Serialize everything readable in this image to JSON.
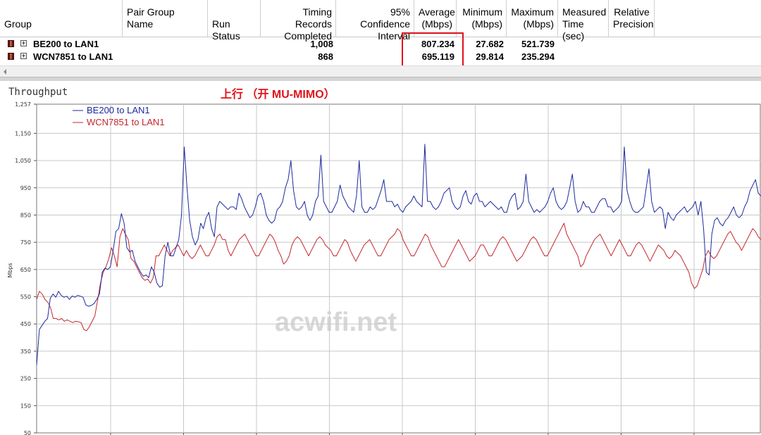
{
  "table": {
    "columns": [
      {
        "key": "group",
        "label": "Group"
      },
      {
        "key": "pair_group_name",
        "label": "Pair Group\nName"
      },
      {
        "key": "run_status",
        "label": "Run Status"
      },
      {
        "key": "timing_records",
        "label": "Timing Records\nCompleted"
      },
      {
        "key": "confidence",
        "label": "95% Confidence\nInterval"
      },
      {
        "key": "average",
        "label": "Average\n(Mbps)"
      },
      {
        "key": "minimum",
        "label": "Minimum\n(Mbps)"
      },
      {
        "key": "maximum",
        "label": "Maximum\n(Mbps)"
      },
      {
        "key": "measured_time",
        "label": "Measured\nTime (sec)"
      },
      {
        "key": "relative_precision",
        "label": "Relative\nPrecision"
      }
    ],
    "rows": [
      {
        "group": "BE200 to LAN1",
        "timing_records": "1,008",
        "average": "807.234",
        "minimum": "27.682",
        "maximum": "521.739"
      },
      {
        "group": "WCN7851 to LAN1",
        "timing_records": "868",
        "average": "695.119",
        "minimum": "29.814",
        "maximum": "235.294"
      }
    ]
  },
  "chart_title_label": "Throughput",
  "annotation": "上行 （开 MU-MIMO）",
  "watermark": "acwifi.net",
  "colors": {
    "highlight": "#e0101a",
    "annotation": "#e0121a",
    "series_blue": "#1c2a9e",
    "series_red": "#c4262b",
    "grid": "#c8c8c8"
  },
  "chart_data": {
    "type": "line",
    "ylabel": "Mbps",
    "ylim": [
      50,
      1257
    ],
    "y_ticks": [
      "50",
      "150",
      "250",
      "350",
      "450",
      "550",
      "650",
      "750",
      "850",
      "950",
      "1,050",
      "1,150",
      "1,257"
    ],
    "legend_placement": "top-left",
    "grid": true,
    "series": [
      {
        "name": "BE200 to LAN1",
        "color": "#1c2a9e",
        "values": [
          300,
          430,
          445,
          460,
          470,
          545,
          560,
          548,
          570,
          555,
          548,
          552,
          540,
          553,
          548,
          555,
          552,
          548,
          520,
          515,
          518,
          525,
          540,
          560,
          640,
          655,
          650,
          660,
          720,
          790,
          800,
          855,
          820,
          730,
          715,
          720,
          680,
          660,
          640,
          625,
          630,
          620,
          660,
          640,
          600,
          585,
          590,
          700,
          750,
          700,
          700,
          730,
          760,
          850,
          1100,
          950,
          830,
          770,
          740,
          760,
          820,
          800,
          840,
          860,
          800,
          770,
          880,
          900,
          890,
          880,
          870,
          880,
          880,
          870,
          930,
          910,
          880,
          860,
          840,
          850,
          880,
          920,
          930,
          900,
          850,
          830,
          820,
          830,
          870,
          880,
          900,
          950,
          980,
          1050,
          940,
          880,
          870,
          880,
          900,
          850,
          830,
          850,
          900,
          920,
          1070,
          900,
          880,
          860,
          860,
          880,
          900,
          960,
          920,
          900,
          880,
          870,
          860,
          920,
          1050,
          880,
          860,
          860,
          880,
          870,
          880,
          910,
          940,
          980,
          900,
          900,
          900,
          880,
          890,
          870,
          860,
          880,
          890,
          900,
          920,
          900,
          890,
          880,
          1110,
          900,
          900,
          880,
          870,
          880,
          900,
          930,
          940,
          950,
          900,
          880,
          870,
          880,
          920,
          940,
          900,
          890,
          920,
          930,
          900,
          900,
          880,
          890,
          900,
          890,
          880,
          870,
          880,
          860,
          860,
          900,
          920,
          930,
          870,
          880,
          900,
          1000,
          900,
          880,
          860,
          870,
          860,
          870,
          880,
          900,
          930,
          950,
          900,
          880,
          870,
          880,
          900,
          950,
          1000,
          900,
          860,
          870,
          900,
          880,
          880,
          860,
          860,
          880,
          900,
          910,
          910,
          880,
          880,
          860,
          870,
          880,
          900,
          1100,
          940,
          900,
          870,
          860,
          860,
          870,
          880,
          950,
          1020,
          900,
          860,
          870,
          880,
          870,
          800,
          860,
          840,
          830,
          850,
          860,
          870,
          880,
          860,
          870,
          880,
          900,
          850,
          900,
          800,
          640,
          630,
          780,
          830,
          840,
          820,
          810,
          830,
          840,
          860,
          880,
          850,
          840,
          850,
          880,
          900,
          940,
          960,
          980,
          930,
          920
        ],
        "values_note": "approximate trace read from the plot across the x-range (relative sample index)"
      },
      {
        "name": "WCN7851 to LAN1",
        "color": "#c4262b",
        "values": [
          540,
          570,
          560,
          540,
          530,
          510,
          470,
          470,
          465,
          470,
          460,
          465,
          460,
          455,
          460,
          458,
          455,
          430,
          425,
          440,
          460,
          480,
          540,
          600,
          640,
          660,
          690,
          730,
          700,
          660,
          770,
          800,
          780,
          760,
          690,
          680,
          660,
          640,
          620,
          610,
          615,
          600,
          620,
          700,
          700,
          720,
          740,
          720,
          700,
          720,
          730,
          740,
          720,
          700,
          720,
          700,
          690,
          700,
          720,
          740,
          720,
          700,
          700,
          720,
          740,
          770,
          780,
          760,
          760,
          720,
          700,
          720,
          740,
          760,
          770,
          780,
          760,
          740,
          720,
          700,
          700,
          720,
          740,
          760,
          780,
          770,
          750,
          720,
          700,
          670,
          680,
          700,
          740,
          760,
          770,
          760,
          740,
          720,
          700,
          720,
          740,
          760,
          770,
          760,
          740,
          730,
          720,
          700,
          700,
          720,
          740,
          760,
          750,
          720,
          700,
          680,
          700,
          720,
          740,
          750,
          760,
          740,
          720,
          700,
          700,
          720,
          740,
          760,
          770,
          780,
          800,
          790,
          760,
          740,
          720,
          700,
          700,
          720,
          740,
          760,
          780,
          770,
          740,
          720,
          700,
          680,
          660,
          660,
          680,
          700,
          720,
          740,
          760,
          740,
          720,
          700,
          680,
          690,
          700,
          720,
          740,
          740,
          720,
          700,
          700,
          720,
          740,
          760,
          770,
          760,
          740,
          720,
          700,
          680,
          690,
          700,
          720,
          740,
          760,
          770,
          760,
          740,
          720,
          700,
          700,
          720,
          740,
          760,
          780,
          800,
          820,
          780,
          760,
          740,
          720,
          700,
          660,
          670,
          700,
          720,
          740,
          760,
          770,
          780,
          760,
          740,
          720,
          700,
          720,
          740,
          760,
          740,
          720,
          700,
          700,
          720,
          740,
          750,
          740,
          720,
          700,
          680,
          700,
          720,
          740,
          730,
          720,
          700,
          690,
          700,
          720,
          710,
          700,
          680,
          660,
          640,
          600,
          580,
          590,
          620,
          650,
          700,
          720,
          700,
          690,
          700,
          720,
          740,
          760,
          780,
          790,
          770,
          750,
          740,
          720,
          740,
          760,
          780,
          800,
          790,
          770,
          760
        ]
      }
    ]
  }
}
